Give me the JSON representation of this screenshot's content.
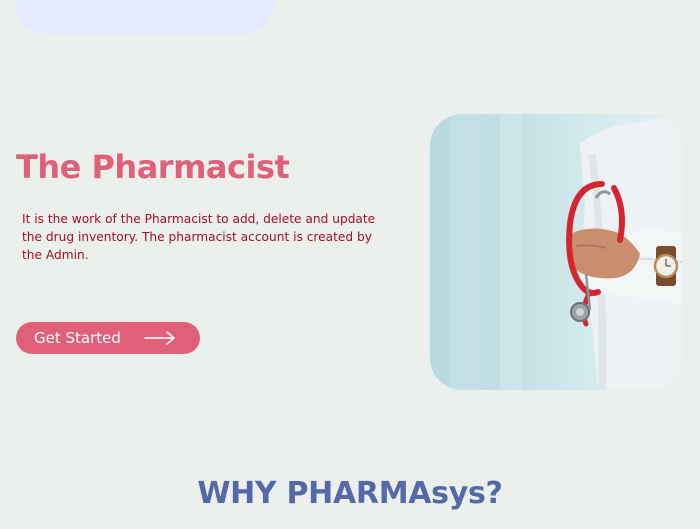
{
  "hero": {
    "title": "The Pharmacist",
    "description": "It is the work of the Pharmacist to add, delete and update the drug inventory. The pharmacist account is created by the Admin.",
    "cta_label": "Get Started",
    "cta_icon": "arrow-right-icon",
    "image": "doctor-with-stethoscope-photo"
  },
  "section": {
    "title": "WHY PHARMAsys?"
  },
  "colors": {
    "background": "#ecf0ec",
    "accent_pink": "#e0607a",
    "description_text": "#a30f24",
    "section_title": "#5469a8",
    "top_card": "#e6eaff"
  }
}
